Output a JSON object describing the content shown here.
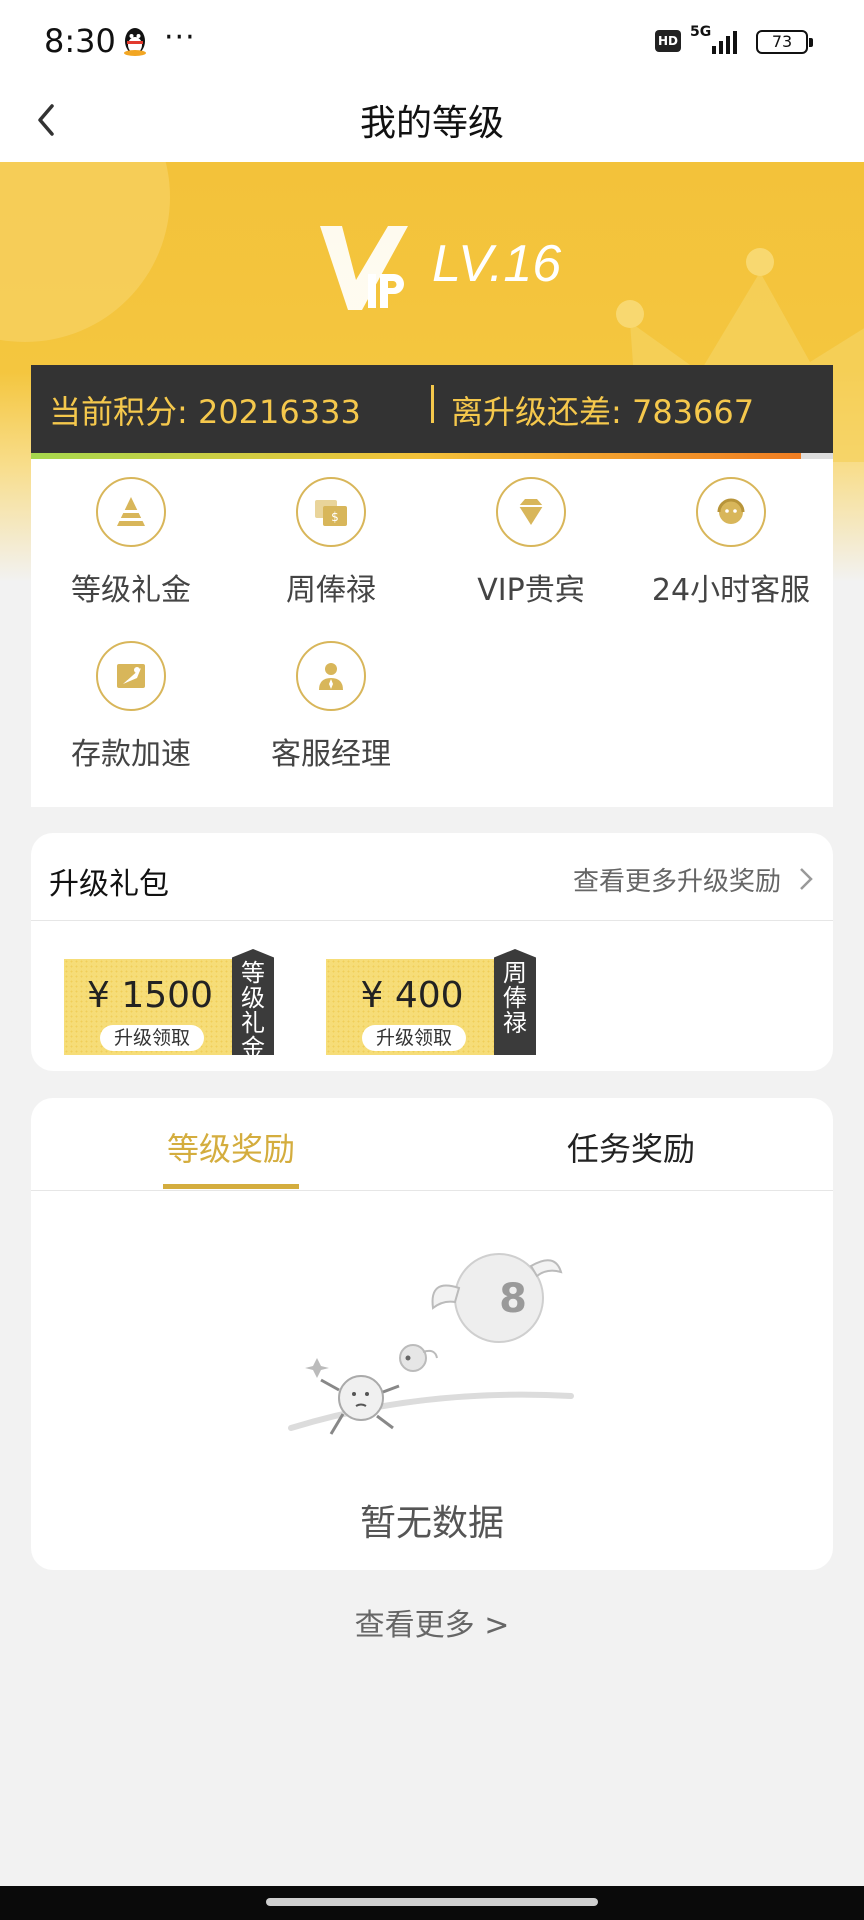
{
  "status_bar": {
    "time": "8:30",
    "dots": "···",
    "hd": "HD",
    "network": "5G",
    "battery": "73"
  },
  "nav": {
    "title": "我的等级",
    "back_icon": "chevron-left-icon"
  },
  "hero": {
    "level": "LV.16"
  },
  "points": {
    "current": "当前积分: 20216333",
    "to_upgrade": "离升级还差: 783667",
    "progress_fraction": 0.96,
    "bar_color": "#333333",
    "text_color": "#f5c84c"
  },
  "privileges": [
    {
      "label": "等级礼金",
      "icon": "pyramid-icon"
    },
    {
      "label": "周俸禄",
      "icon": "money-icon"
    },
    {
      "label": "VIP贵宾",
      "icon": "diamond-icon"
    },
    {
      "label": "24小时客服",
      "icon": "headset-icon"
    },
    {
      "label": "存款加速",
      "icon": "rocket-icon"
    },
    {
      "label": "客服经理",
      "icon": "manager-icon"
    }
  ],
  "upgrade_gift": {
    "title": "升级礼包",
    "more_label": "查看更多升级奖励",
    "coupons": [
      {
        "amount": "¥ 1500",
        "action": "升级领取",
        "tag": "等级礼金"
      },
      {
        "amount": "¥ 400",
        "action": "升级领取",
        "tag": "周俸禄"
      }
    ]
  },
  "rewards": {
    "tabs": [
      {
        "label": "等级奖励",
        "active": true
      },
      {
        "label": "任务奖励",
        "active": false
      }
    ],
    "empty_text": "暂无数据"
  },
  "footer": {
    "view_more": "查看更多 >"
  },
  "colors": {
    "accent": "#d4ad3e",
    "hero_yellow": "#f3c23a"
  }
}
